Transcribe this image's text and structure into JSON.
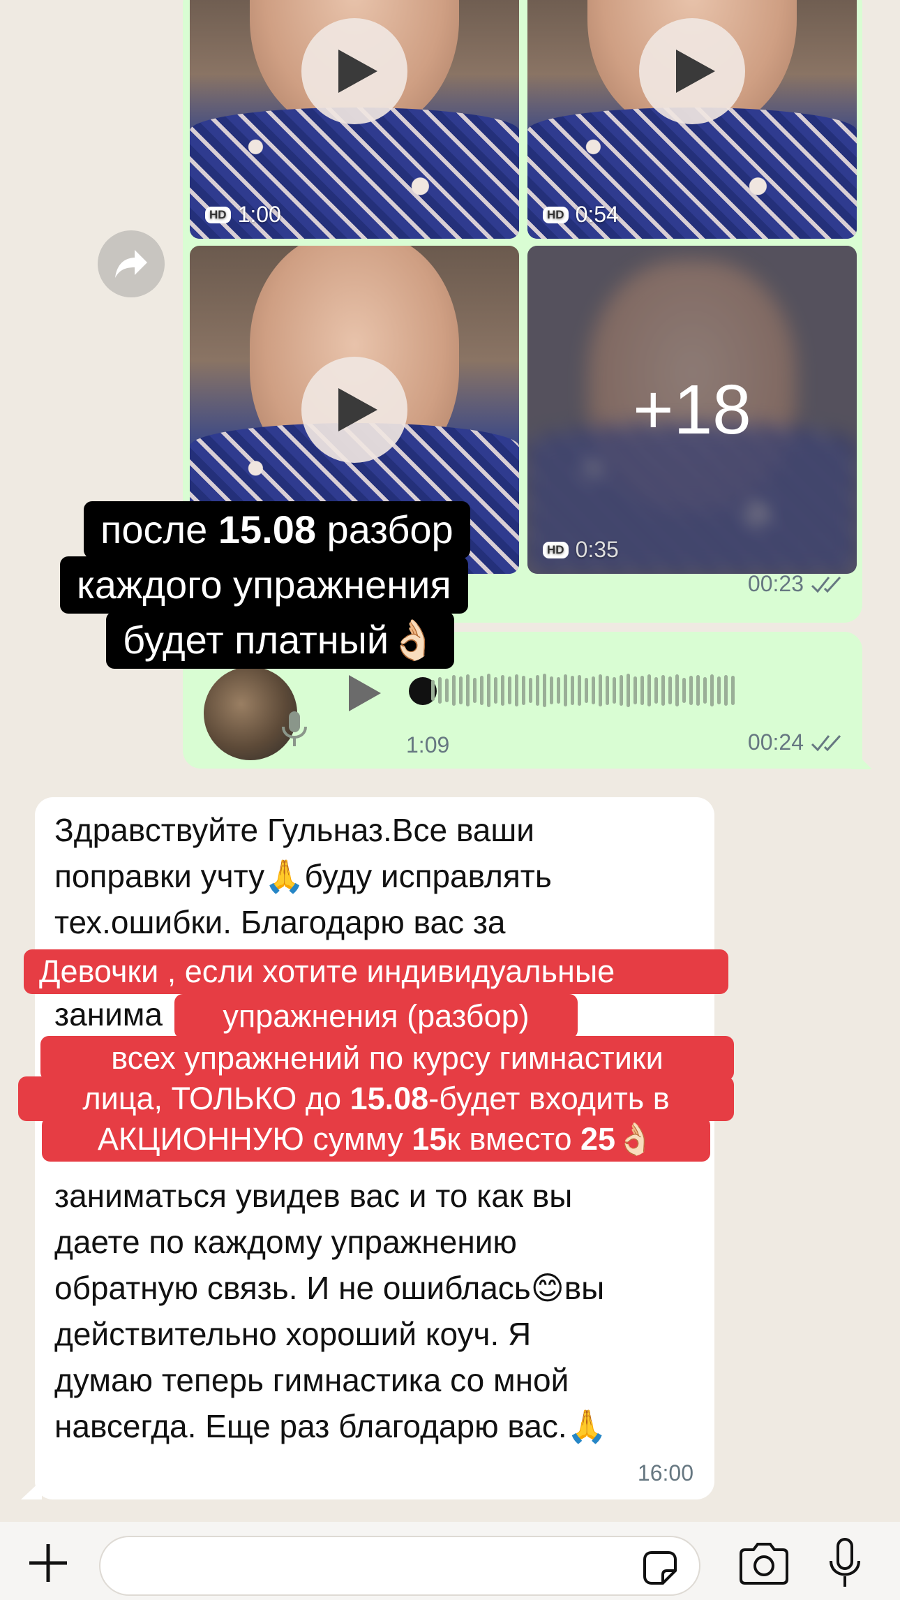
{
  "media_message": {
    "videos": [
      {
        "duration": "1:00",
        "hd_label": "HD"
      },
      {
        "duration": "0:54",
        "hd_label": "HD"
      },
      {
        "duration": "",
        "hd_label": ""
      },
      {
        "duration": "0:35",
        "hd_label": "HD"
      }
    ],
    "more_count": "+18",
    "time": "00:23"
  },
  "voice_message": {
    "duration": "1:09",
    "time": "00:24"
  },
  "incoming_message": {
    "lines": [
      "Здравствуйте Гульназ.Все ваши",
      "поправки учту",
      "буду исправлять",
      "тех.ошибки. Благодарю вас за",
      "занима",
      "заниматься увидев вас и то как вы",
      "даете по каждому упражнению",
      "обратную связь. И не ошиблась",
      "вы",
      "действительно хороший коуч. Я",
      "думаю теперь гимнастика со мной",
      "навсегда. Еще раз благодарю вас."
    ],
    "emoji_pray": "🙏",
    "emoji_smile": "😊",
    "time": "16:00"
  },
  "overlay_black": {
    "line1_a": "после ",
    "line1_b": "15.08",
    "line1_c": " разбор",
    "line2": "каждого упражнения",
    "line3": "будет платный",
    "emoji_ok": "👌🏻"
  },
  "overlay_red": {
    "line1": "Девочки , если хотите индивидуальные",
    "line2": "упражнения (разбор)",
    "line3": "всех упражнений по курсу гимнастики",
    "line4_a": "лица, ТОЛЬКО до ",
    "line4_b": "15.08",
    "line4_c": "-будет входить в",
    "line5_a": "АКЦИОННУЮ сумму ",
    "line5_b": "15",
    "line5_c": "к вместо ",
    "line5_d": "25",
    "emoji_ok": "👌🏻"
  },
  "colors": {
    "outgoing_bubble": "#d9fdd3",
    "incoming_bubble": "#ffffff",
    "chat_background": "#efeae2",
    "red_overlay": "#e63d44"
  },
  "icons": [
    "play-icon",
    "forward-icon",
    "double-check-icon",
    "mic-icon",
    "plus-icon",
    "sticker-icon",
    "camera-icon"
  ]
}
